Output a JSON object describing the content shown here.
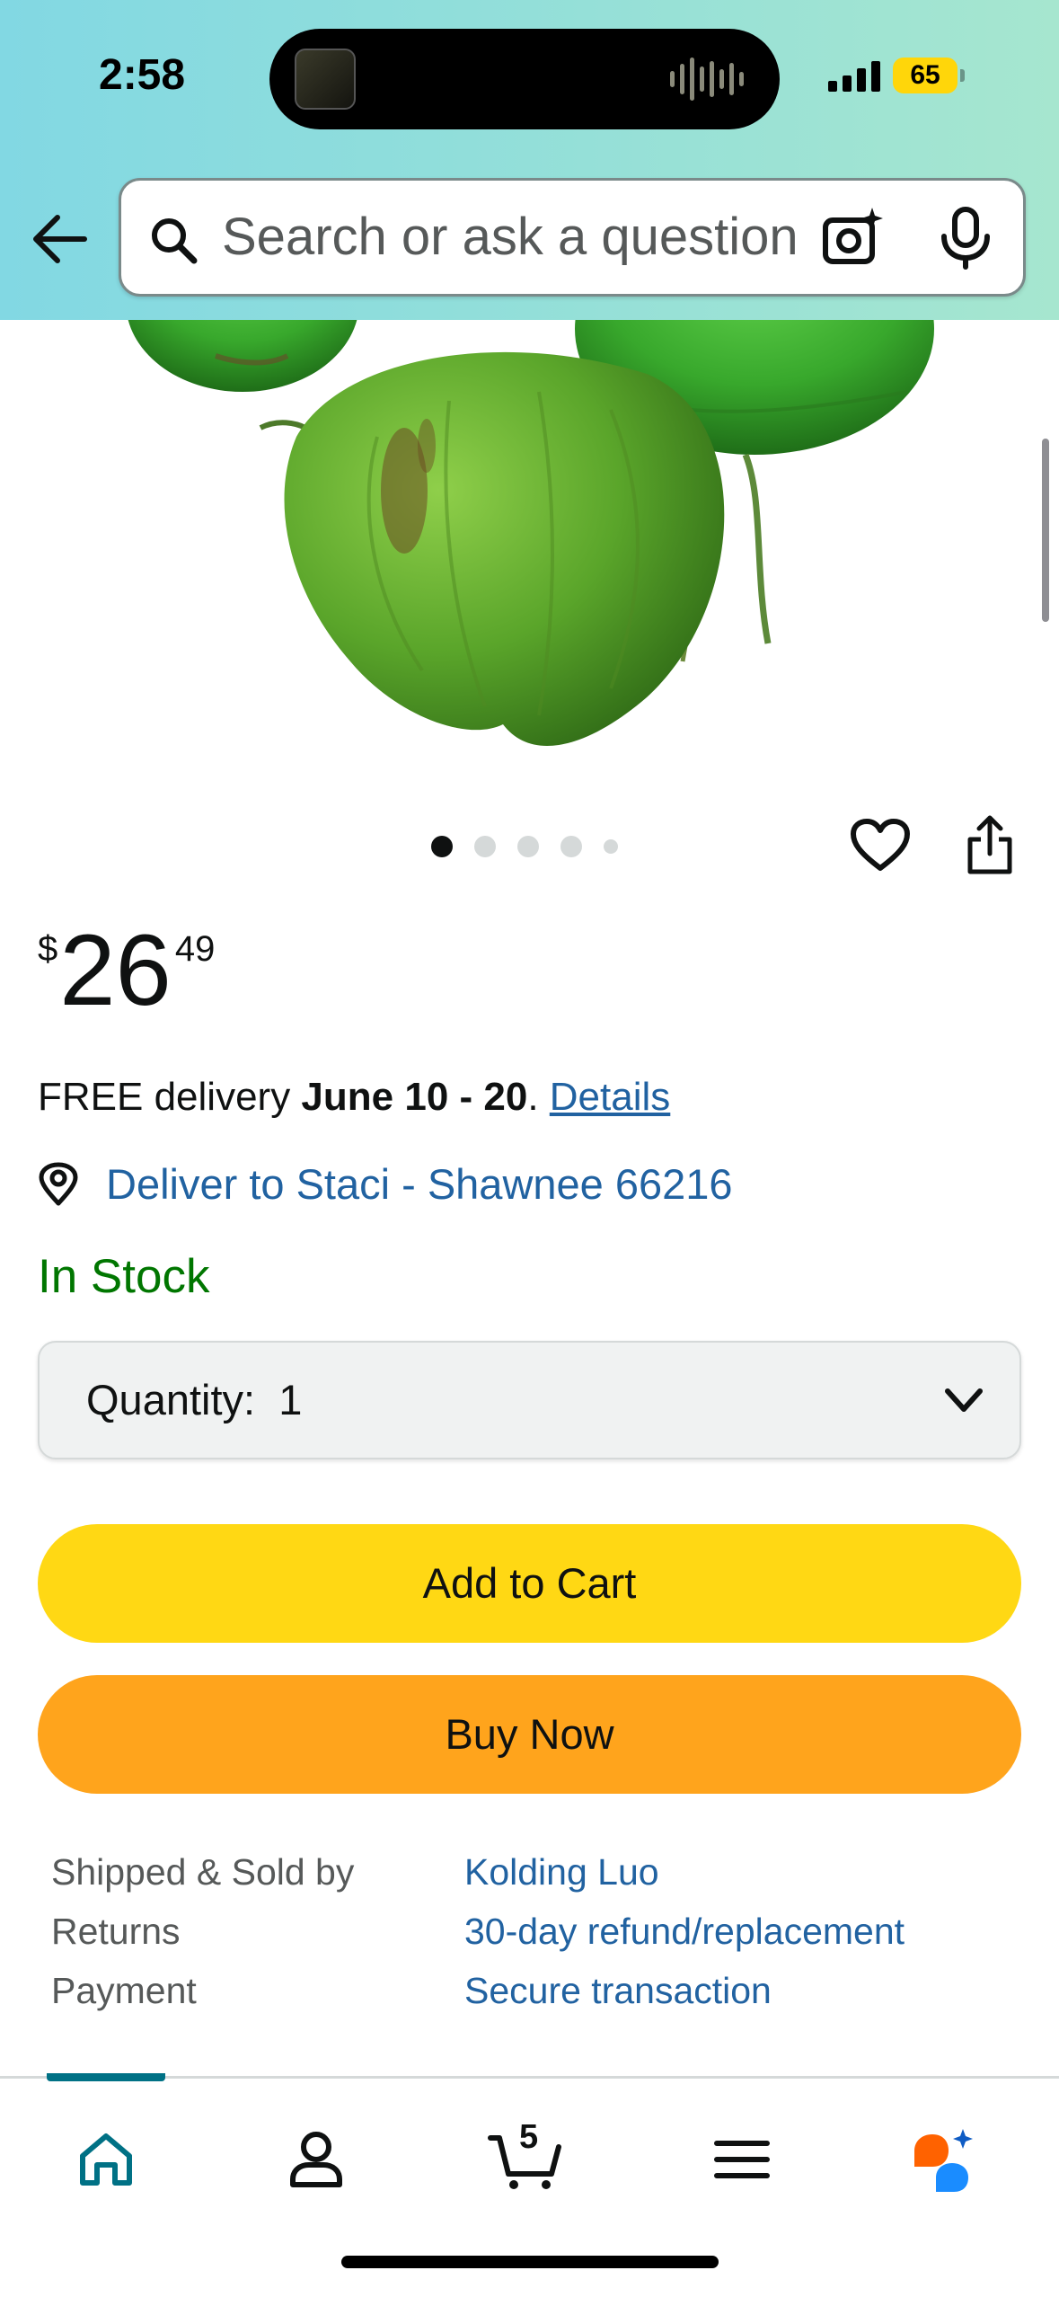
{
  "status_bar": {
    "time": "2:58",
    "battery": "65"
  },
  "search": {
    "placeholder": "Search or ask a question"
  },
  "product": {
    "image_count": 5,
    "current_image": 1,
    "price": {
      "symbol": "$",
      "whole": "26",
      "fraction": "49"
    },
    "delivery": {
      "prefix": "FREE delivery ",
      "dates": "June 10 - 20",
      "separator": ". ",
      "details_link": "Details"
    },
    "deliver_to": "Deliver to Staci - Shawnee 66216",
    "stock": "In Stock",
    "quantity_label": "Quantity:",
    "quantity_value": "1",
    "add_to_cart": "Add to Cart",
    "buy_now": "Buy Now",
    "info": [
      {
        "key": "Shipped & Sold by",
        "value": "Kolding Luo"
      },
      {
        "key": "Returns",
        "value": "30-day refund/replacement"
      },
      {
        "key": "Payment",
        "value": "Secure transaction"
      }
    ]
  },
  "nav": {
    "cart_count": "5",
    "active": "home"
  },
  "colors": {
    "link": "#2162a1",
    "in_stock": "#007600",
    "add_to_cart": "#ffd814",
    "buy_now": "#ffa41c",
    "nav_active": "#007185"
  }
}
